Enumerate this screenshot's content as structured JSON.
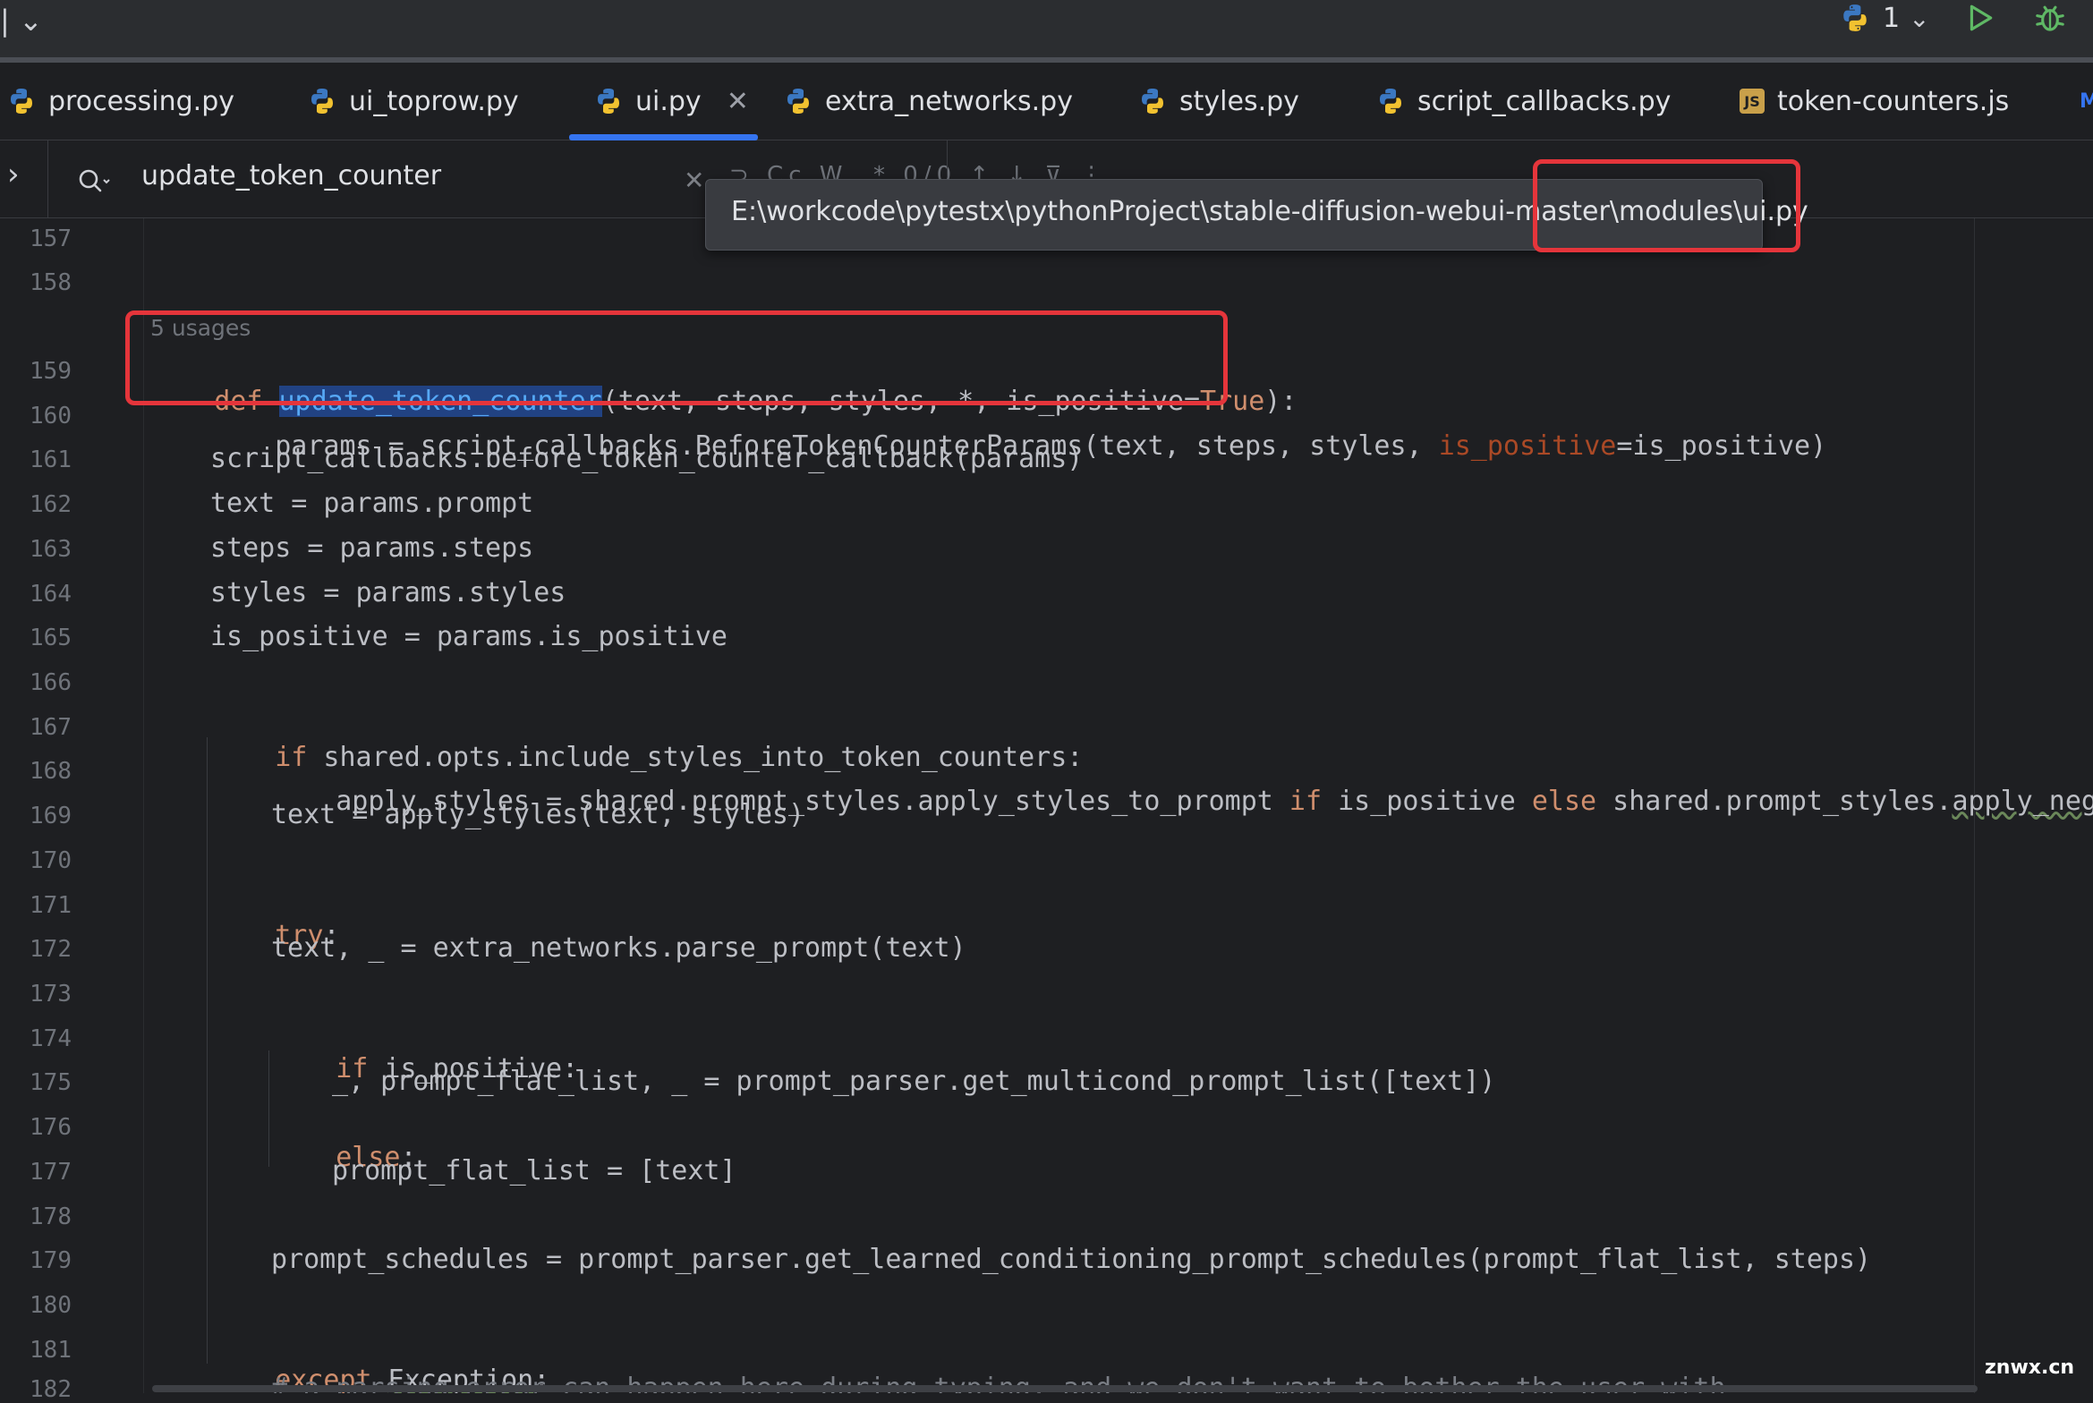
{
  "toolbar": {
    "left_glyph": "| ⌄",
    "run_config_count": "1",
    "chevron": "⌄"
  },
  "tabs": [
    {
      "label": "processing.py",
      "icon": "python-icon"
    },
    {
      "label": "ui_toprow.py",
      "icon": "python-icon"
    },
    {
      "label": "ui.py",
      "icon": "python-icon",
      "active": true,
      "close": "✕"
    },
    {
      "label": "extra_networks.py",
      "icon": "python-icon"
    },
    {
      "label": "styles.py",
      "icon": "python-icon"
    },
    {
      "label": "script_callbacks.py",
      "icon": "python-icon"
    },
    {
      "label": "token-counters.js",
      "icon": "js-icon",
      "icon_text": "JS"
    },
    {
      "label": "M",
      "partial": true
    }
  ],
  "search": {
    "expand": "›",
    "query": "update_token_counter",
    "close": "✕",
    "hidden_controls": "⊃ Cc W .* 0/0 ↑ ↓ ⊽ ⋮"
  },
  "tooltip": {
    "path": "E:\\workcode\\pytestx\\pythonProject\\stable-diffusion-webui-master\\modules\\ui.py"
  },
  "editor": {
    "usages_hint": "5 usages",
    "line_numbers": [
      "157",
      "158",
      "159",
      "160",
      "161",
      "162",
      "163",
      "164",
      "165",
      "166",
      "167",
      "168",
      "169",
      "170",
      "171",
      "172",
      "173",
      "174",
      "175",
      "176",
      "177",
      "178",
      "179",
      "180",
      "181",
      "182"
    ]
  },
  "code": {
    "l159_def": "def ",
    "l159_fn": "update_token_counter",
    "l159_a": "(text, steps, styles, *, is_positive=",
    "l159_true": "True",
    "l159_b": "):",
    "l160_a": "params = script_callbacks.BeforeTokenCounterParams(text, steps, styles, ",
    "l160_kw": "is_positive",
    "l160_b": "=is_positive)",
    "l161": "script_callbacks.before_token_counter_callback(params)",
    "l162": "text = params.prompt",
    "l163": "steps = params.steps",
    "l164": "styles = params.styles",
    "l165": "is_positive = params.is_positive",
    "l167_if": "if",
    "l167_b": " shared.opts.include_styles_into_token_counters:",
    "l168_a": "apply_styles = shared.prompt_styles.apply_styles_to_prompt ",
    "l168_if": "if",
    "l168_b": " is_positive ",
    "l168_else": "else",
    "l168_c": " shared.prompt_styles.",
    "l168_d": "apply_negative_style",
    "l169": "text = apply_styles(text, styles)",
    "l171_try": "try",
    "l171_colon": ":",
    "l172": "text, _ = extra_networks.parse_prompt(text)",
    "l174_if": "if",
    "l174_b": " is_positive:",
    "l175": "_, prompt_flat_list, _ = prompt_parser.get_multicond_prompt_list([text])",
    "l176_else": "else",
    "l176_colon": ":",
    "l177": "prompt_flat_list = [text]",
    "l179": "prompt_schedules = prompt_parser.get_learned_conditioning_prompt_schedules(prompt_flat_list, steps)",
    "l181_except": "except",
    "l181_sp": " ",
    "l181_exc": "Exception",
    "l181_colon": ":",
    "l182": "# a parsing error can happen here during typing, and we don't want to bother the user with"
  },
  "watermark": "znwx.cn",
  "colors": {
    "background": "#1e1f22",
    "keyword": "#cf8e6d",
    "function": "#56a8f5",
    "highlight_box": "#e5353b",
    "active_tab_underline": "#3574f0",
    "run_green": "#5fb865"
  }
}
